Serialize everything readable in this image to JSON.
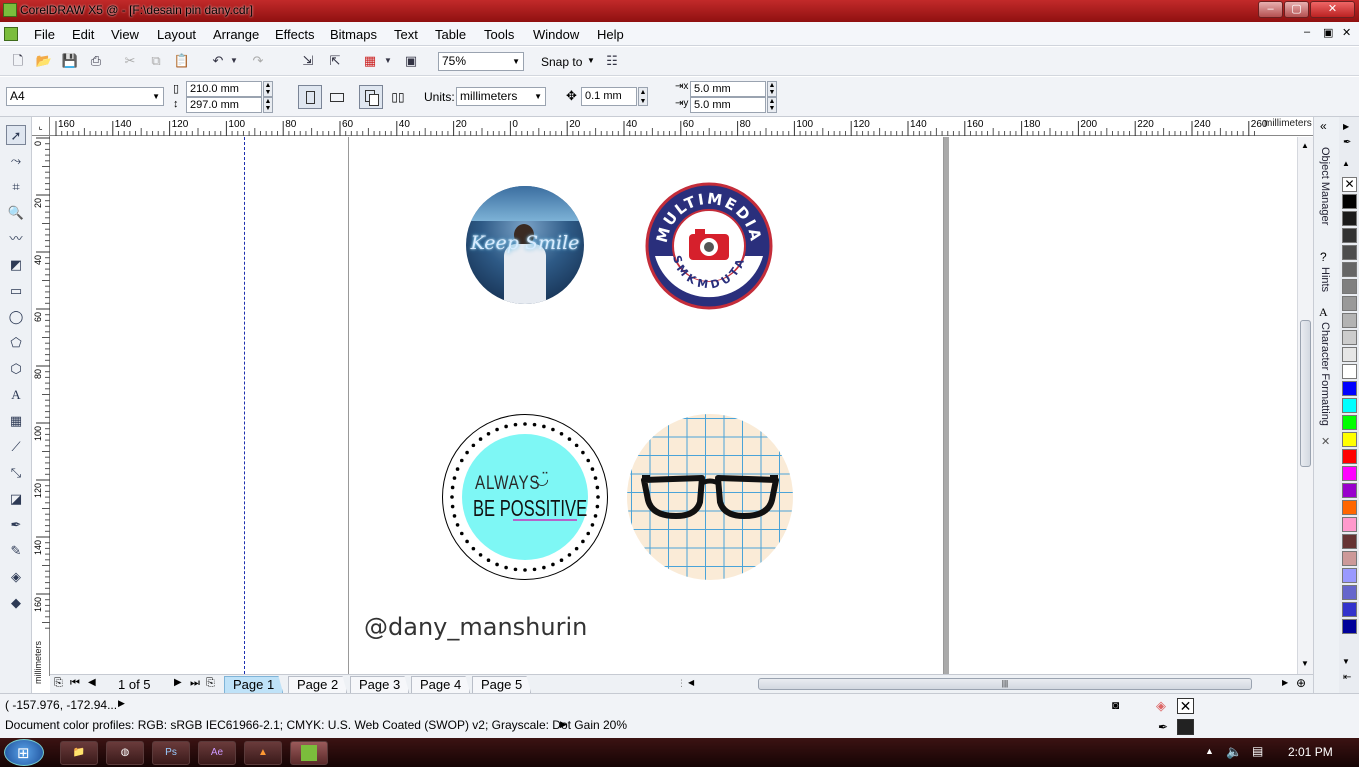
{
  "window": {
    "title": "CorelDRAW X5 @ - [F:\\desain pin dany.cdr]",
    "controls": [
      "minimize-icon",
      "maximize-icon",
      "close-icon"
    ]
  },
  "menu": {
    "items": [
      "File",
      "Edit",
      "View",
      "Layout",
      "Arrange",
      "Effects",
      "Bitmaps",
      "Text",
      "Table",
      "Tools",
      "Window",
      "Help"
    ]
  },
  "toolbar": {
    "zoom_value": "75%",
    "snap_label": "Snap to"
  },
  "property_bar": {
    "page_size": "A4",
    "width": "210.0 mm",
    "height": "297.0 mm",
    "units_label": "Units:",
    "units_value": "millimeters",
    "nudge": "0.1 mm",
    "dup_x": "5.0 mm",
    "dup_y": "5.0 mm"
  },
  "rulers": {
    "unit": "millimeters",
    "top_ticks": [
      "160",
      "140",
      "120",
      "100",
      "80",
      "60",
      "40",
      "20",
      "0",
      "20",
      "40",
      "60",
      "80",
      "100",
      "120",
      "140",
      "160",
      "180",
      "200",
      "220",
      "240",
      "260"
    ],
    "left_ticks": [
      "0",
      "20",
      "40",
      "60",
      "80",
      "100",
      "120",
      "140",
      "160"
    ]
  },
  "canvas": {
    "pin1_text": "Keep Smile",
    "pin2_top": "MULTIMEDIA",
    "pin2_bottom": "SMKMDUTA",
    "pin3_line1": "ALWAYS",
    "pin3_line2": "BE POSSITIVE",
    "credit": "@dany_manshurin"
  },
  "dockers": {
    "tabs": [
      "Object Manager",
      "Hints",
      "Character Formatting"
    ]
  },
  "pages": {
    "counter": "1 of 5",
    "tabs": [
      "Page 1",
      "Page 2",
      "Page 3",
      "Page 4",
      "Page 5"
    ],
    "active": "Page 1"
  },
  "status": {
    "coords": "( -157.976, -172.94...",
    "profiles": "Document color profiles: RGB: sRGB IEC61966-2.1; CMYK: U.S. Web Coated (SWOP) v2; Grayscale: Dot Gain 20%"
  },
  "palette_colors": [
    "#000000",
    "#1a1a1a",
    "#333333",
    "#4d4d4d",
    "#666666",
    "#808080",
    "#999999",
    "#b3b3b3",
    "#cccccc",
    "#e6e6e6",
    "#ffffff",
    "#0000ff",
    "#00ffff",
    "#00ff00",
    "#ffff00",
    "#ff0000",
    "#ff00ff",
    "#9900cc",
    "#ff6600",
    "#ff99cc",
    "#663333",
    "#cc9999",
    "#9999ff",
    "#6666cc",
    "#3333cc",
    "#000099"
  ],
  "taskbar": {
    "apps": [
      "explorer-icon",
      "chrome-icon",
      "Ps",
      "Ae",
      "vlc-icon",
      "coreldraw-icon"
    ],
    "clock": "2:01 PM"
  }
}
